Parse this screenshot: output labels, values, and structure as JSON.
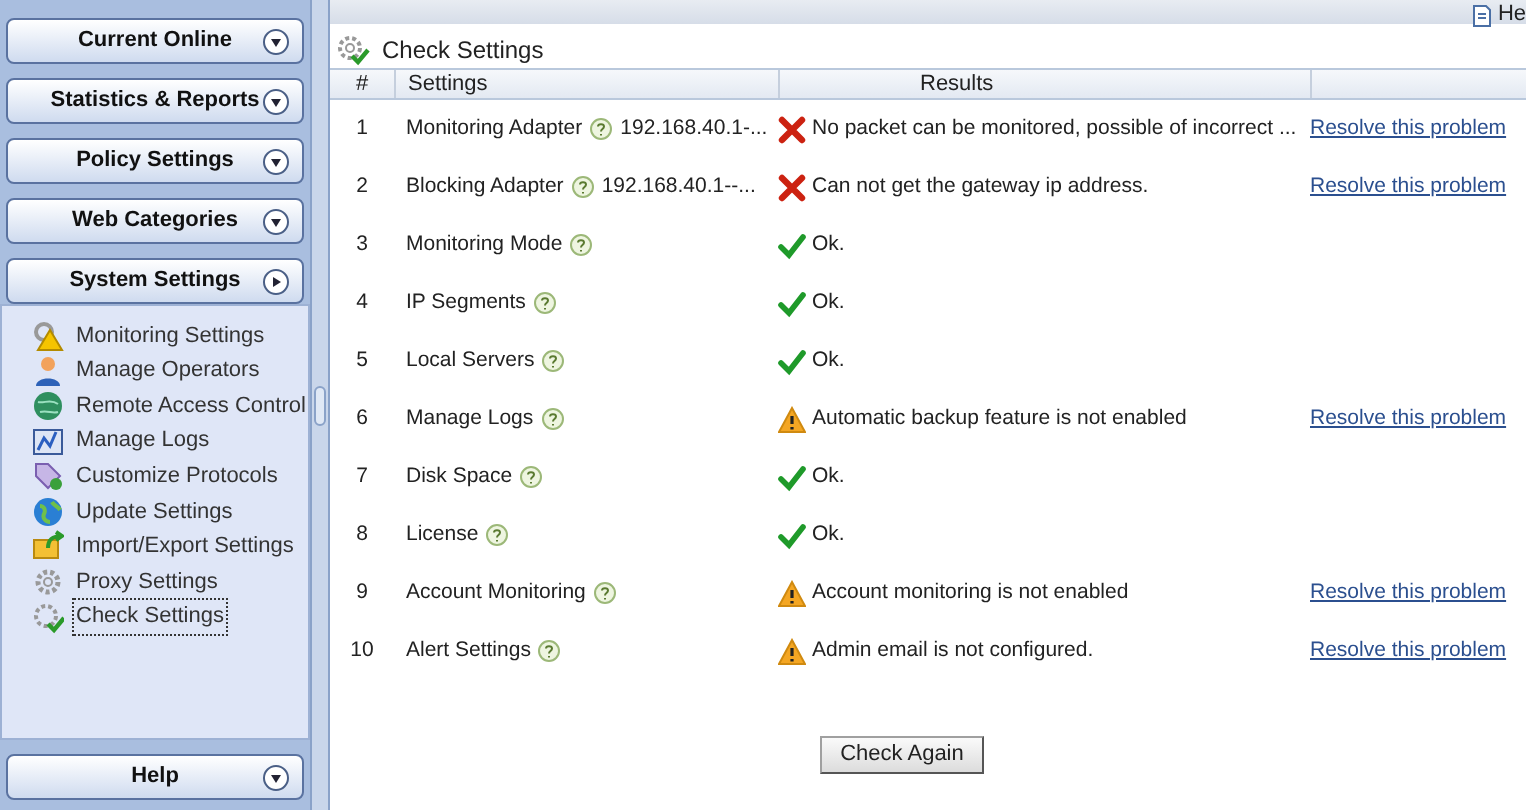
{
  "sidebar": {
    "sections": [
      {
        "label": "Current Online",
        "expanded": false
      },
      {
        "label": "Statistics & Reports",
        "expanded": false
      },
      {
        "label": "Policy Settings",
        "expanded": false
      },
      {
        "label": "Web Categories",
        "expanded": false
      },
      {
        "label": "System Settings",
        "expanded": true,
        "items": [
          {
            "label": "Monitoring Settings",
            "selected": false
          },
          {
            "label": "Manage Operators",
            "selected": false
          },
          {
            "label": "Remote Access Control",
            "selected": false
          },
          {
            "label": "Manage Logs",
            "selected": false
          },
          {
            "label": "Customize Protocols",
            "selected": false
          },
          {
            "label": "Update Settings",
            "selected": false
          },
          {
            "label": "Import/Export Settings",
            "selected": false
          },
          {
            "label": "Proxy Settings",
            "selected": false
          },
          {
            "label": "Check Settings",
            "selected": true
          }
        ]
      }
    ],
    "footer_section": {
      "label": "Help",
      "expanded": false
    }
  },
  "top_link": "He",
  "title": "Check Settings",
  "table": {
    "columns": [
      "#",
      "Settings",
      "Results"
    ],
    "rows": [
      {
        "number": "1",
        "setting": "Monitoring Adapter",
        "value": "192.168.40.1-...",
        "kind": "error",
        "result": "No packet can be monitored, possible of incorrect ...",
        "action": "Resolve this problem"
      },
      {
        "number": "2",
        "setting": "Blocking Adapter",
        "value": "192.168.40.1--...",
        "kind": "error",
        "result": "Can not get the gateway ip address.",
        "action": "Resolve this problem"
      },
      {
        "number": "3",
        "setting": "Monitoring Mode",
        "kind": "ok",
        "result": "Ok."
      },
      {
        "number": "4",
        "setting": "IP Segments",
        "kind": "ok",
        "result": "Ok."
      },
      {
        "number": "5",
        "setting": "Local Servers",
        "kind": "ok",
        "result": "Ok."
      },
      {
        "number": "6",
        "setting": "Manage Logs",
        "kind": "warning",
        "result": "Automatic backup feature is not enabled",
        "action": "Resolve this problem"
      },
      {
        "number": "7",
        "setting": "Disk Space",
        "kind": "ok",
        "result": "Ok."
      },
      {
        "number": "8",
        "setting": "License",
        "kind": "ok",
        "result": "Ok."
      },
      {
        "number": "9",
        "setting": "Account Monitoring",
        "kind": "warning",
        "result": "Account monitoring is not enabled",
        "action": "Resolve this problem"
      },
      {
        "number": "10",
        "setting": "Alert Settings",
        "kind": "warning",
        "result": "Admin email is not configured.",
        "action": "Resolve this problem"
      }
    ]
  },
  "button": "Check Again"
}
